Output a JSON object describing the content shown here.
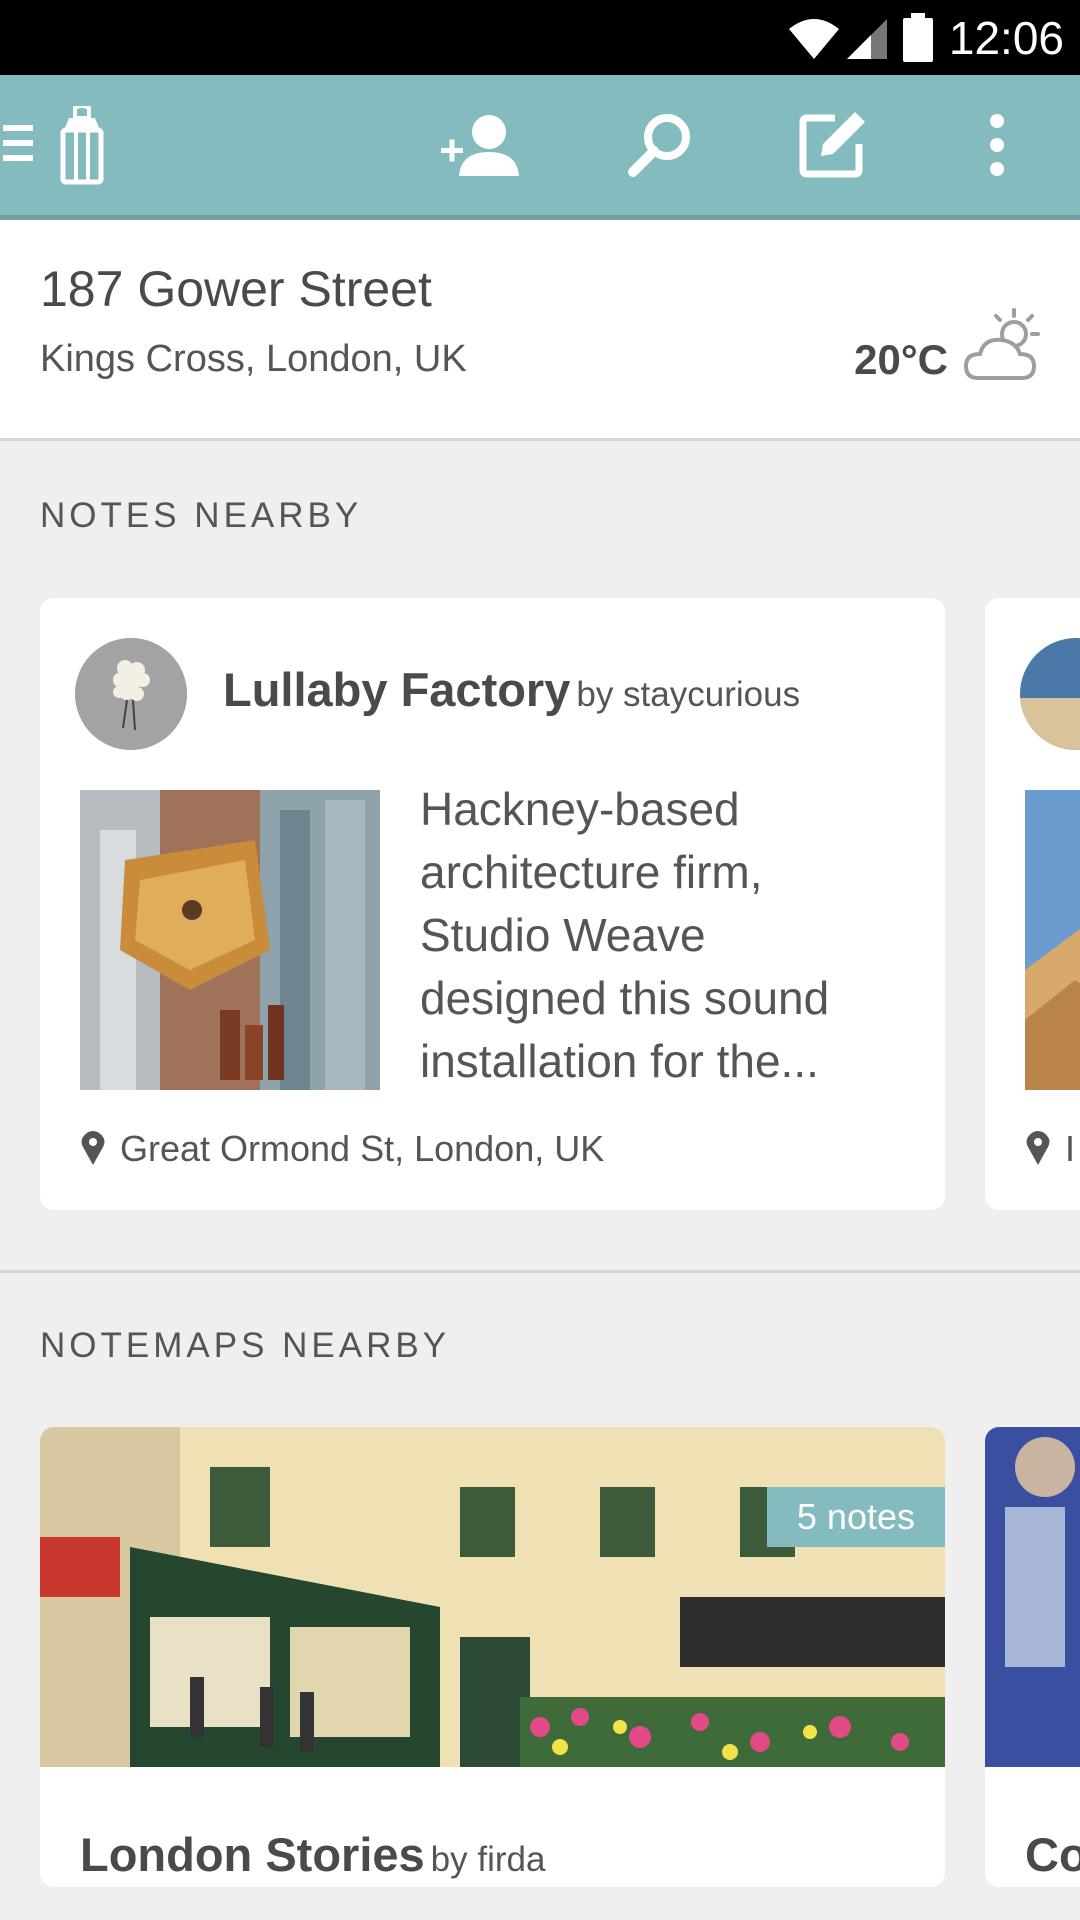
{
  "status_bar": {
    "time": "12:06"
  },
  "app_bar": {
    "icons": [
      "menu-icon",
      "lantern-icon",
      "add-person-icon",
      "search-icon",
      "compose-icon",
      "more-vert-icon"
    ]
  },
  "location": {
    "street": "187 Gower Street",
    "area": "Kings Cross, London, UK",
    "temperature": "20°C",
    "weather_icon": "partly-cloudy-icon"
  },
  "notes_nearby": {
    "heading": "NOTES NEARBY",
    "cards": [
      {
        "title": "Lullaby Factory",
        "author": "by staycurious",
        "excerpt": "Hackney-based architecture firm, Studio Weave designed this sound installation for the...",
        "place": "Great Ormond St, London, UK"
      },
      {
        "place": "I"
      }
    ]
  },
  "notemaps_nearby": {
    "heading": "NOTEMAPS NEARBY",
    "cards": [
      {
        "title": "London Stories",
        "author": "by firda",
        "badge": "5 notes"
      },
      {
        "title": "Co"
      }
    ]
  },
  "colors": {
    "accent": "#84bbbf",
    "status_bar": "#000000",
    "background": "#efefef"
  }
}
